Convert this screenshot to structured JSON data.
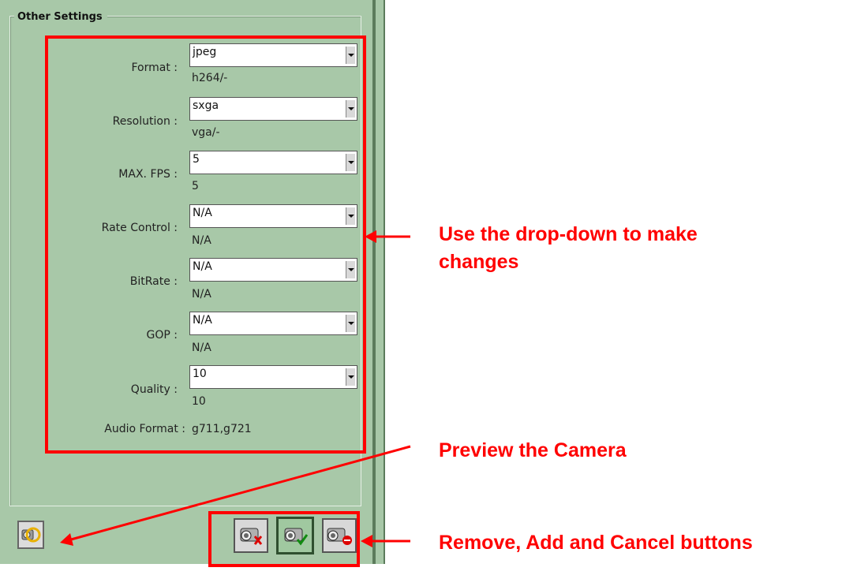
{
  "fieldset": {
    "legend": "Other Settings"
  },
  "settings": [
    {
      "label": "Format :",
      "selected": "jpeg",
      "current": "h264/-"
    },
    {
      "label": "Resolution :",
      "selected": "sxga",
      "current": "vga/-"
    },
    {
      "label": "MAX. FPS :",
      "selected": "5",
      "current": "5"
    },
    {
      "label": "Rate Control :",
      "selected": "N/A",
      "current": "N/A"
    },
    {
      "label": "BitRate :",
      "selected": "N/A",
      "current": "N/A"
    },
    {
      "label": "GOP :",
      "selected": "N/A",
      "current": "N/A"
    },
    {
      "label": "Quality :",
      "selected": "10",
      "current": "10"
    }
  ],
  "audio": {
    "label": "Audio Format :",
    "value": "g711,g721"
  },
  "annotations": {
    "dropdown_line1": "Use the drop-down to make",
    "dropdown_line2": "changes",
    "preview": "Preview the Camera",
    "buttons": "Remove, Add and Cancel buttons"
  },
  "buttons": [
    {
      "name": "preview-camera",
      "icon": "camera-preview-icon"
    },
    {
      "name": "remove-camera",
      "icon": "camera-remove-icon"
    },
    {
      "name": "add-camera",
      "icon": "camera-add-icon"
    },
    {
      "name": "cancel",
      "icon": "camera-cancel-icon"
    }
  ],
  "colors": {
    "panel": "#a8c8a8",
    "annotation": "#ff0000"
  }
}
